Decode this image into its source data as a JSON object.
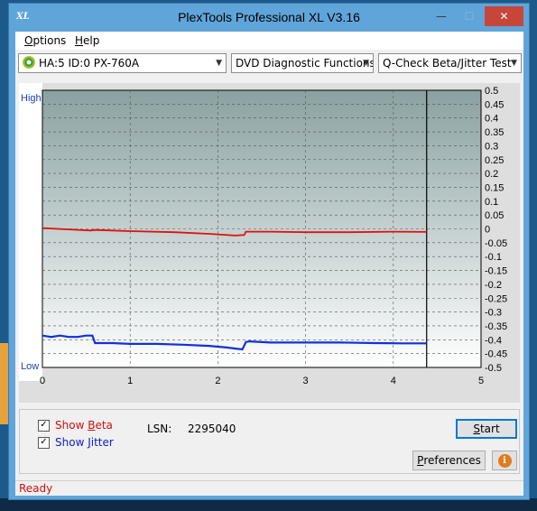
{
  "window": {
    "title": "PlexTools Professional XL V3.16",
    "logo_text": "XL",
    "min_glyph": "—",
    "max_glyph": "☐",
    "close_glyph": "✕"
  },
  "menu": {
    "options_first": "O",
    "options_rest": "ptions",
    "help_first": "H",
    "help_rest": "elp"
  },
  "toolbar": {
    "drive": "HA:5 ID:0  PX-760A",
    "function": "DVD Diagnostic Functions",
    "test": "Q-Check Beta/Jitter Test",
    "arrow_glyph": "▼"
  },
  "chart_data": {
    "type": "line",
    "left_axis_labels": {
      "top": "High",
      "bottom": "Low"
    },
    "x_ticks": [
      "0",
      "1",
      "2",
      "3",
      "4",
      "5"
    ],
    "xlim": [
      0,
      5
    ],
    "y_ticks": [
      "0.5",
      "0.45",
      "0.4",
      "0.35",
      "0.3",
      "0.25",
      "0.2",
      "0.15",
      "0.1",
      "0.05",
      "0",
      "-0.05",
      "-0.1",
      "-0.15",
      "-0.2",
      "-0.25",
      "-0.3",
      "-0.35",
      "-0.4",
      "-0.45",
      "-0.5"
    ],
    "ylim": [
      -0.5,
      0.5
    ],
    "grid": true,
    "scan_end_x": 4.38,
    "series": [
      {
        "color": "#e01010",
        "x": [
          0,
          0.3,
          0.55,
          0.6,
          1.0,
          1.5,
          1.9,
          2.2,
          2.3,
          2.32,
          2.6,
          3.0,
          3.5,
          4.0,
          4.38
        ],
        "y": [
          0.003,
          -0.002,
          -0.006,
          -0.004,
          -0.008,
          -0.012,
          -0.018,
          -0.024,
          -0.022,
          -0.01,
          -0.01,
          -0.012,
          -0.012,
          -0.01,
          -0.011
        ]
      },
      {
        "color": "#1030e0",
        "x": [
          0,
          0.1,
          0.2,
          0.3,
          0.4,
          0.5,
          0.57,
          0.6,
          0.8,
          1.0,
          1.3,
          1.6,
          1.9,
          2.1,
          2.2,
          2.28,
          2.32,
          2.36,
          2.6,
          3.0,
          3.4,
          3.8,
          4.1,
          4.38
        ],
        "y": [
          -0.385,
          -0.39,
          -0.385,
          -0.39,
          -0.39,
          -0.385,
          -0.385,
          -0.412,
          -0.412,
          -0.415,
          -0.415,
          -0.418,
          -0.422,
          -0.428,
          -0.432,
          -0.435,
          -0.408,
          -0.406,
          -0.41,
          -0.41,
          -0.41,
          -0.412,
          -0.413,
          -0.413
        ]
      }
    ]
  },
  "controls": {
    "show_beta_first": "Show ",
    "show_beta_key": "B",
    "show_beta_rest": "eta",
    "show_beta_checked": true,
    "show_jitter_first": "Show ",
    "show_jitter_key": "J",
    "show_jitter_rest": "itter",
    "show_jitter_checked": true,
    "check_glyph": "✓",
    "lsn_label": "LSN:",
    "lsn_value": "2295040",
    "start_key": "S",
    "start_rest": "tart",
    "preferences_key": "P",
    "preferences_rest": "references",
    "info_glyph": "i"
  },
  "colors": {
    "beta_label": "#d01010",
    "jitter_label": "#1020c0"
  },
  "status": {
    "text": "Ready"
  }
}
